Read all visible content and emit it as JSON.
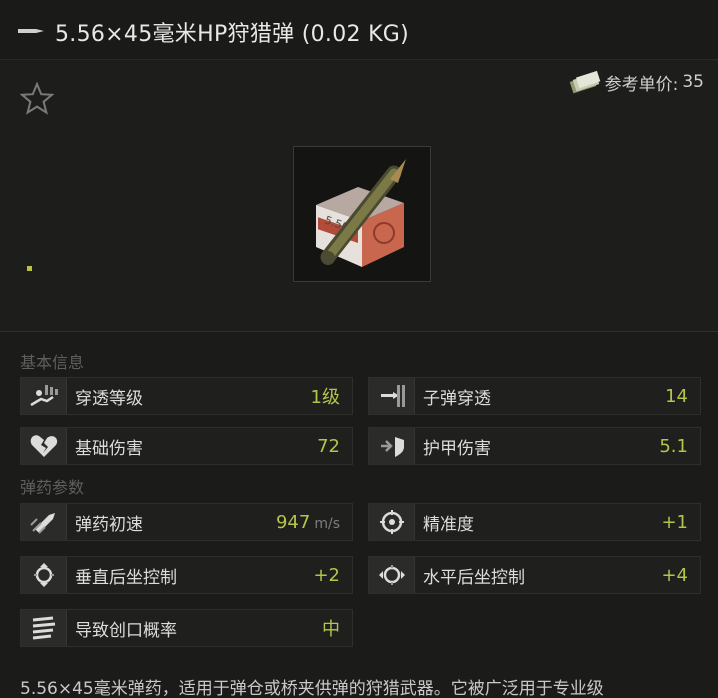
{
  "header": {
    "title": "5.56×45毫米HP狩猎弹 (0.02 KG)"
  },
  "price": {
    "label": "参考单价:",
    "value": "35"
  },
  "sections": {
    "basic_info": "基本信息",
    "ammo_params": "弹药参数"
  },
  "stats": {
    "penetration_level": {
      "label": "穿透等级",
      "value": "1级"
    },
    "bullet_penetration": {
      "label": "子弹穿透",
      "value": "14"
    },
    "base_damage": {
      "label": "基础伤害",
      "value": "72"
    },
    "armor_damage": {
      "label": "护甲伤害",
      "value": "5.1"
    },
    "muzzle_velocity": {
      "label": "弹药初速",
      "value": "947",
      "unit": "m/s"
    },
    "accuracy": {
      "label": "精准度",
      "value": "+1"
    },
    "vertical_recoil": {
      "label": "垂直后坐控制",
      "value": "+2"
    },
    "horizontal_recoil": {
      "label": "水平后坐控制",
      "value": "+4"
    },
    "bleed_chance": {
      "label": "导致创口概率",
      "value": "中"
    }
  },
  "box_label": "5.56",
  "description": "5.56×45毫米弹药，适用于弹仓或桥夹供弹的狩猎武器。它被广泛用于专业级",
  "colors": {
    "value_accent": "#b6c44a",
    "background": "#1b1b1a"
  }
}
